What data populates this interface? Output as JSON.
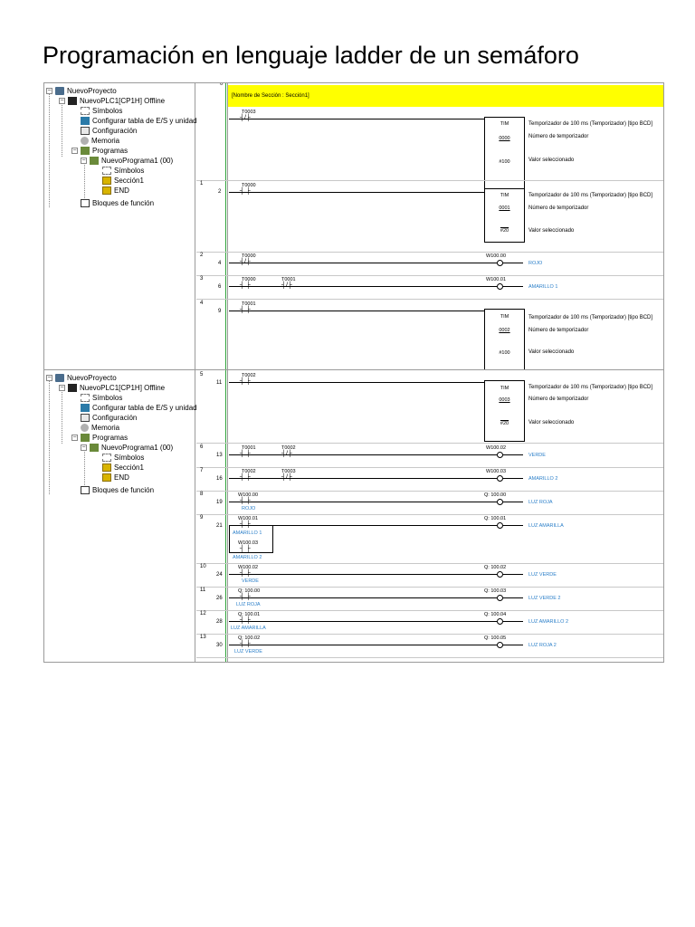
{
  "doc_title": "Programación en lenguaje ladder de un semáforo",
  "tree": {
    "project": "NuevoProyecto",
    "plc": "NuevoPLC1[CP1H] Offline",
    "symbols": "Símbolos",
    "io_table": "Configurar tabla de E/S y unidad",
    "config": "Configuración",
    "memory": "Memoria",
    "programs": "Programas",
    "program1": "NuevoPrograma1 (00)",
    "prog_symbols": "Símbolos",
    "section1": "Sección1",
    "end": "END",
    "function_blocks": "Bloques de función"
  },
  "section_header": "[Nombre de Sección : Sección1]",
  "tim_label": "TIM",
  "tim_comment": "Temporizador de 100 ms (Temporizador) [tipo BCD]",
  "tim_number_label": "Número de temporizador",
  "tim_value_label": "Valor seleccionado",
  "rungs_top": [
    {
      "num": "0",
      "step": "",
      "contact": "T0003",
      "type": "NC",
      "timer": "0000",
      "preset": "#100"
    },
    {
      "num": "1",
      "step": "2",
      "contact": "T0000",
      "type": "NO",
      "timer": "0001",
      "preset": "#20"
    },
    {
      "num": "2",
      "step": "4",
      "contact": "T0000",
      "type": "NC",
      "coil": "W100.00",
      "coil_comment": "ROJO"
    },
    {
      "num": "3",
      "step": "6",
      "contact": "T0000",
      "contact2": "T0001",
      "coil": "W100.01",
      "coil_comment": "AMARILLO 1"
    },
    {
      "num": "4",
      "step": "9",
      "contact": "T0001",
      "type": "NO",
      "timer": "0002",
      "preset": "#100"
    }
  ],
  "rungs_bottom": [
    {
      "num": "5",
      "step": "11",
      "contact": "T0002",
      "timer": "0003",
      "preset": "#20"
    },
    {
      "num": "6",
      "step": "13",
      "contact": "T0001",
      "contact2": "T0002",
      "coil": "W100.02",
      "coil_comment": "VERDE"
    },
    {
      "num": "7",
      "step": "16",
      "contact": "T0002",
      "contact2": "T0003",
      "coil": "W100.03",
      "coil_comment": "AMARILLO 2"
    },
    {
      "num": "8",
      "step": "19",
      "contact": "W100.00",
      "contact_comment": "ROJO",
      "coil": "Q: 100.00",
      "coil_comment": "LUZ ROJA"
    },
    {
      "num": "9",
      "step": "21",
      "contact": "W100.01",
      "contact_comment": "AMARILLO 1",
      "contact_b": "W100.03",
      "contact_b_comment": "AMARILLO 2",
      "coil": "Q: 100.01",
      "coil_comment": "LUZ AMARILLA"
    },
    {
      "num": "10",
      "step": "24",
      "contact": "W100.02",
      "contact_comment": "VERDE",
      "coil": "Q: 100.02",
      "coil_comment": "LUZ VERDE"
    },
    {
      "num": "11",
      "step": "26",
      "contact": "Q: 100.00",
      "contact_comment": "LUZ ROJA",
      "coil": "Q: 100.03",
      "coil_comment": "LUZ VERDE 2"
    },
    {
      "num": "12",
      "step": "28",
      "contact": "Q: 100.01",
      "contact_comment": "LUZ AMARILLA",
      "coil": "Q: 100.04",
      "coil_comment": "LUZ AMARILLO 2"
    },
    {
      "num": "13",
      "step": "30",
      "contact": "Q: 100.02",
      "contact_comment": "LUZ VERDE",
      "coil": "Q: 100.05",
      "coil_comment": "LUZ ROJA 2"
    }
  ]
}
